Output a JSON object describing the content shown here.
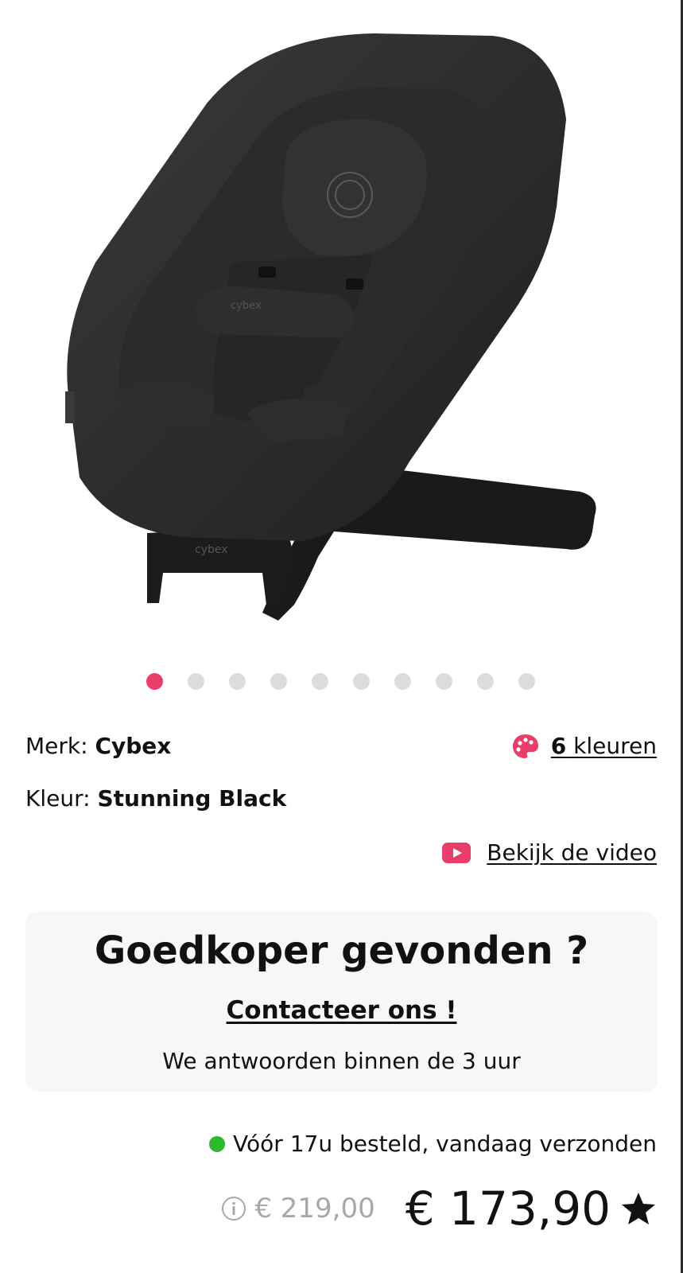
{
  "product": {
    "image_alt": "Cybex Lemo Bouncer",
    "carousel": {
      "total": 10,
      "active": 1
    }
  },
  "details": {
    "brand_label": "Merk:",
    "brand_value": "Cybex",
    "color_label": "Kleur:",
    "color_value": "Stunning Black",
    "colors_count": "6",
    "colors_suffix": " kleuren",
    "video_label": "Bekijk de video"
  },
  "promo": {
    "title": "Goedkoper gevonden ?",
    "link": "Contacteer ons !",
    "text": "We antwoorden binnen de 3 uur"
  },
  "shipping": {
    "text": "Vóór 17u besteld, vandaag verzonden",
    "status_color": "#2eb82e"
  },
  "pricing": {
    "old_price": "€ 219,00",
    "new_price": "€ 173,90"
  },
  "colors": {
    "accent": "#e93e6a",
    "panel": "#f7f7f7"
  },
  "icons": {
    "palette": "palette-icon",
    "video": "youtube-icon",
    "info": "info-icon",
    "favorite": "star-icon"
  }
}
